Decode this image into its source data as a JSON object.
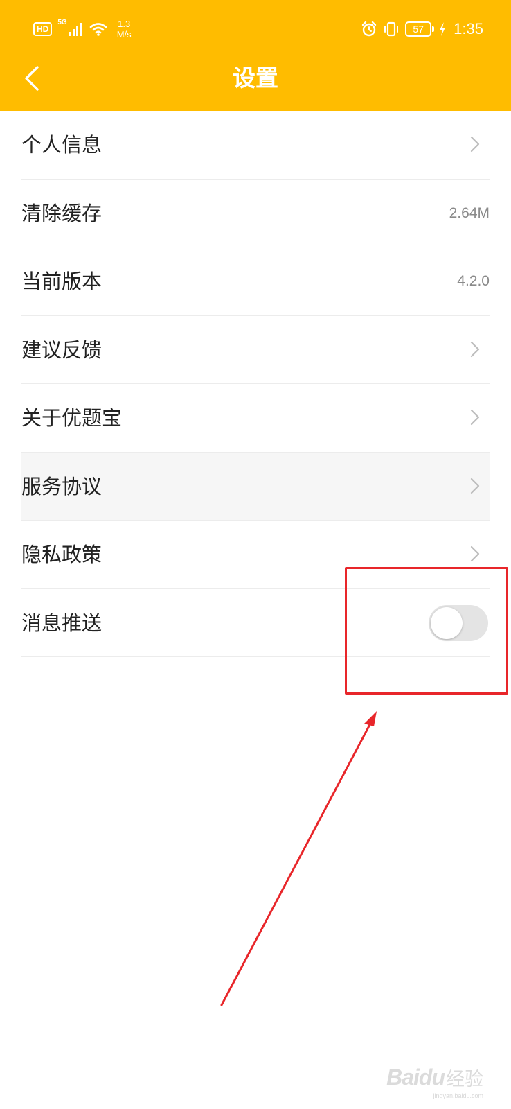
{
  "status_bar": {
    "hd": "HD",
    "network": "5G",
    "speed_value": "1.3",
    "speed_unit": "M/s",
    "battery": "57",
    "time": "1:35"
  },
  "header": {
    "title": "设置",
    "accent_color": "#FFBC00"
  },
  "settings": {
    "items": [
      {
        "label": "个人信息",
        "value": "",
        "type": "link"
      },
      {
        "label": "清除缓存",
        "value": "2.64M",
        "type": "value"
      },
      {
        "label": "当前版本",
        "value": "4.2.0",
        "type": "value"
      },
      {
        "label": "建议反馈",
        "value": "",
        "type": "link"
      },
      {
        "label": "关于优题宝",
        "value": "",
        "type": "link"
      },
      {
        "label": "服务协议",
        "value": "",
        "type": "link",
        "pressed": true
      },
      {
        "label": "隐私政策",
        "value": "",
        "type": "link"
      },
      {
        "label": "消息推送",
        "value": "",
        "type": "toggle",
        "toggle_on": false
      }
    ]
  },
  "annotation": {
    "color": "#e8262a"
  },
  "watermark": {
    "brand": "Baidu",
    "sub": "经验",
    "url": "jingyan.baidu.com"
  }
}
